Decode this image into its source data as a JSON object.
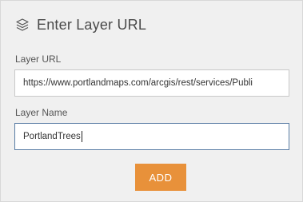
{
  "header": {
    "icon": "layers-icon",
    "title": "Enter Layer URL"
  },
  "layer_url": {
    "label": "Layer URL",
    "value": "https://www.portlandmaps.com/arcgis/rest/services/Publi"
  },
  "layer_name": {
    "label": "Layer Name",
    "value": "PortlandTrees"
  },
  "add_button": {
    "label": "ADD",
    "color": "#e8913a"
  }
}
